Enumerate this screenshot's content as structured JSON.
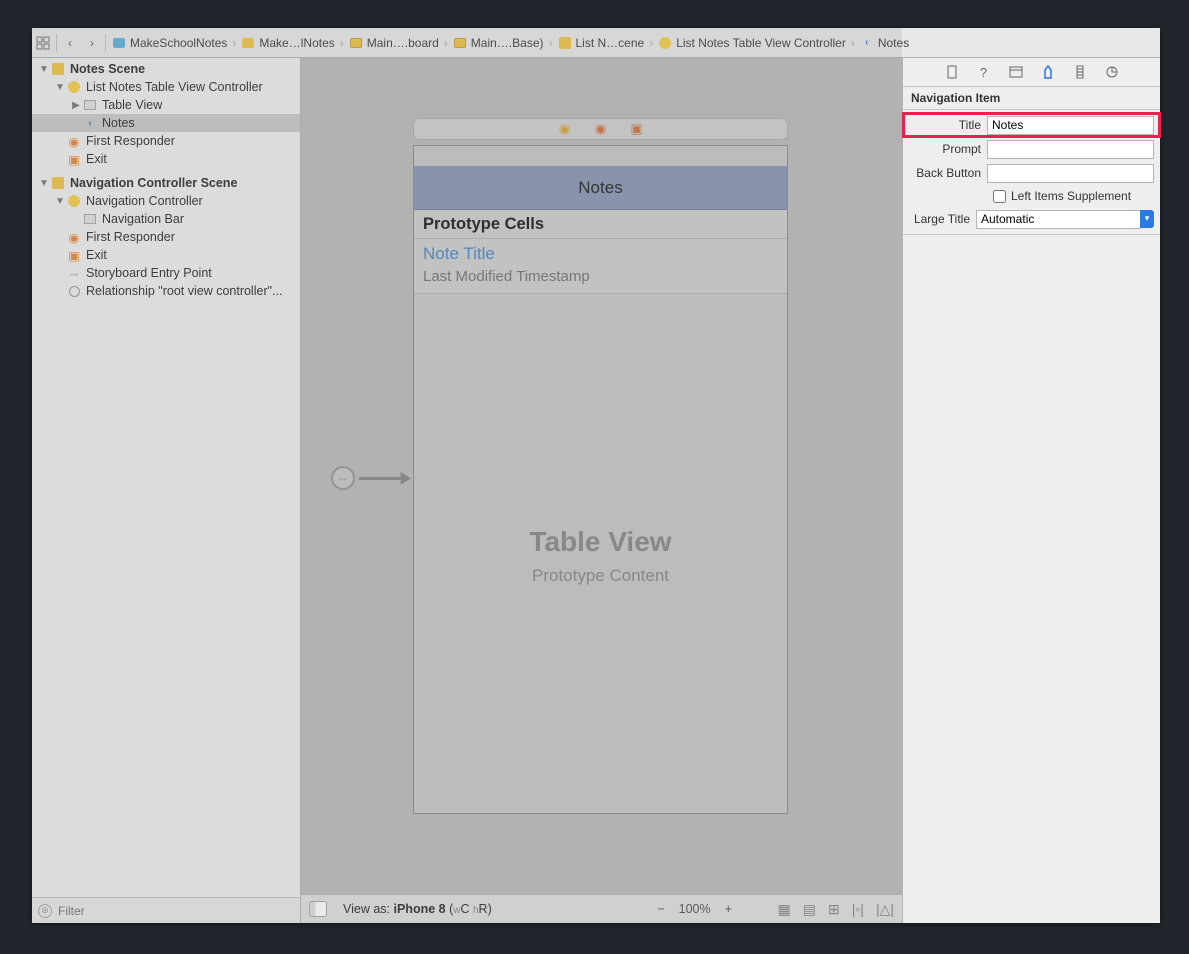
{
  "breadcrumb": {
    "grid_icon": "grid",
    "back_icon": "back",
    "fwd_icon": "forward",
    "items": [
      {
        "icon": "proj",
        "label": "MakeSchoolNotes"
      },
      {
        "icon": "folder",
        "label": "Make…lNotes"
      },
      {
        "icon": "sb",
        "label": "Main….board"
      },
      {
        "icon": "sb",
        "label": "Main….Base)"
      },
      {
        "icon": "scene",
        "label": "List N…cene"
      },
      {
        "icon": "vc",
        "label": "List Notes Table View Controller"
      },
      {
        "icon": "back",
        "label": "Notes"
      }
    ]
  },
  "outline": {
    "scene1": {
      "title": "Notes Scene",
      "vc": "List Notes Table View Controller",
      "tableview": "Table View",
      "notes": "Notes",
      "first_responder": "First Responder",
      "exit": "Exit"
    },
    "scene2": {
      "title": "Navigation Controller Scene",
      "vc": "Navigation Controller",
      "navbar": "Navigation Bar",
      "first_responder": "First Responder",
      "exit": "Exit",
      "entry": "Storyboard Entry Point",
      "rel": "Relationship \"root view controller\"..."
    },
    "filter_placeholder": "Filter"
  },
  "canvas": {
    "nav_title": "Notes",
    "proto_header": "Prototype Cells",
    "cell_title": "Note Title",
    "cell_ts": "Last Modified Timestamp",
    "watermark1": "Table View",
    "watermark2": "Prototype Content"
  },
  "bottombar": {
    "view_as_prefix": "View as: ",
    "view_as_device": "iPhone 8",
    "view_as_wc": "w",
    "view_as_cv": "C",
    "view_as_hr": "h",
    "view_as_rv": "R",
    "zoom": "100%"
  },
  "inspector": {
    "header": "Navigation Item",
    "title_label": "Title",
    "title_value": "Notes",
    "prompt_label": "Prompt",
    "prompt_value": "",
    "back_label": "Back Button",
    "back_value": "",
    "supplement_label": "Left Items Supplement",
    "large_title_label": "Large Title",
    "large_title_value": "Automatic"
  }
}
